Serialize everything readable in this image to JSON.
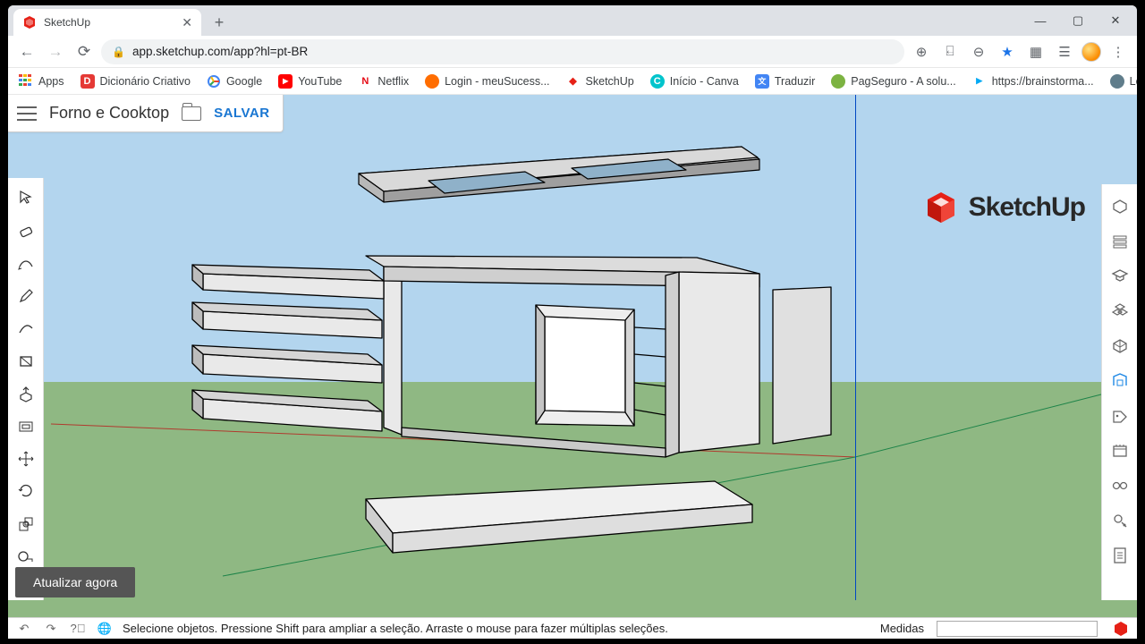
{
  "browser": {
    "tab_title": "SketchUp",
    "url": "app.sketchup.com/app?hl=pt-BR",
    "window_controls": {
      "min": "—",
      "max": "▢",
      "close": "✕"
    }
  },
  "bookmarks": {
    "apps": "Apps",
    "items": [
      {
        "label": "Dicionário Criativo",
        "icon_bg": "#e53935",
        "icon_txt": "D"
      },
      {
        "label": "Google",
        "icon_bg": "#fff",
        "icon_txt": "G"
      },
      {
        "label": "YouTube",
        "icon_bg": "#ff0000",
        "icon_txt": "▶"
      },
      {
        "label": "Netflix",
        "icon_bg": "#fff",
        "icon_txt": "N"
      },
      {
        "label": "Login - meuSucess...",
        "icon_bg": "#ff6d00",
        "icon_txt": "●"
      },
      {
        "label": "SketchUp",
        "icon_bg": "#e62117",
        "icon_txt": "◆"
      },
      {
        "label": "Início - Canva",
        "icon_bg": "#00c4cc",
        "icon_txt": "C"
      },
      {
        "label": "Traduzir",
        "icon_bg": "#4285f4",
        "icon_txt": "文"
      },
      {
        "label": "PagSeguro - A solu...",
        "icon_bg": "#7cb342",
        "icon_txt": "●"
      },
      {
        "label": "https://brainstorma...",
        "icon_bg": "#03a9f4",
        "icon_txt": "▶"
      },
      {
        "label": "Login",
        "icon_bg": "#607d8b",
        "icon_txt": "●"
      }
    ],
    "overflow": "»"
  },
  "app": {
    "file_title": "Forno e Cooktop",
    "save_label": "SALVAR",
    "logo_text": "SketchUp",
    "update_banner": "Atualizar agora"
  },
  "left_tools": [
    "select",
    "eraser",
    "line-freehand",
    "pencil",
    "arc",
    "rectangle",
    "pushpull",
    "offset",
    "move",
    "rotate",
    "scale",
    "tape",
    "paint"
  ],
  "right_panels": [
    "entity-info",
    "instructor",
    "learn",
    "components",
    "materials",
    "styles",
    "tags",
    "scenes",
    "display",
    "shadows",
    "softedges",
    "reports"
  ],
  "status": {
    "hint": "Selecione objetos. Pressione Shift para ampliar a seleção. Arraste o mouse para fazer múltiplas seleções.",
    "measure_label": "Medidas",
    "measure_value": ""
  }
}
